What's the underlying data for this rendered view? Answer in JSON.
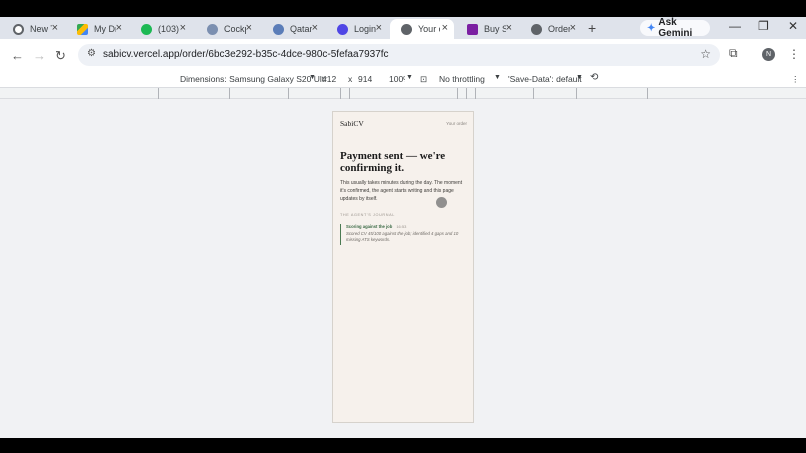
{
  "tabs": [
    {
      "title": "New T",
      "color": "#ffffff",
      "icon": "chrome-icon"
    },
    {
      "title": "My Dr",
      "color": "#34a853",
      "icon": "drive-icon"
    },
    {
      "title": "(103)",
      "color": "#1db954",
      "icon": "whatsapp-icon"
    },
    {
      "title": "Cockp",
      "color": "#7b8fb0",
      "icon": "cockpit-icon"
    },
    {
      "title": "Qatar",
      "color": "#5b7db8",
      "icon": "qatar-icon"
    },
    {
      "title": "Login",
      "color": "#4f46e5",
      "icon": "login-icon"
    },
    {
      "title": "Your o",
      "color": "#5f6368",
      "icon": "globe-icon"
    },
    {
      "title": "Buy S",
      "color": "#7b1fa2",
      "icon": "stripe-icon"
    },
    {
      "title": "Order",
      "color": "#5f6368",
      "icon": "globe-icon"
    }
  ],
  "gemini_label": "Ask Gemini",
  "url": "sabicv.vercel.app/order/6bc3e292-b35c-4dce-980c-5fefaa7937fc",
  "avatar_letter": "N",
  "device": {
    "dimensions_label": "Dimensions: Samsung Galaxy S20 Ultr",
    "width": "412",
    "times": "x",
    "height": "914",
    "zoom": "100%",
    "throttling": "No throttling",
    "save_data": "'Save-Data': default"
  },
  "page": {
    "brand": "SabiCV",
    "your_order": "Your order",
    "heading": "Payment sent — we're confirming it.",
    "body": "This usually takes minutes during the day. The moment it's confirmed, the agent starts writing and this page updates by itself.",
    "journal_label": "THE AGENT'S JOURNAL",
    "entry_title": "Scoring against the job",
    "entry_time": "16:53",
    "entry_desc": "Scored CV 45/100 against the job; identified 4 gaps and 10 missing ATS keywords."
  },
  "colors": {
    "accent_green": "#3c6b46",
    "page_bg": "#f6f1ec"
  }
}
